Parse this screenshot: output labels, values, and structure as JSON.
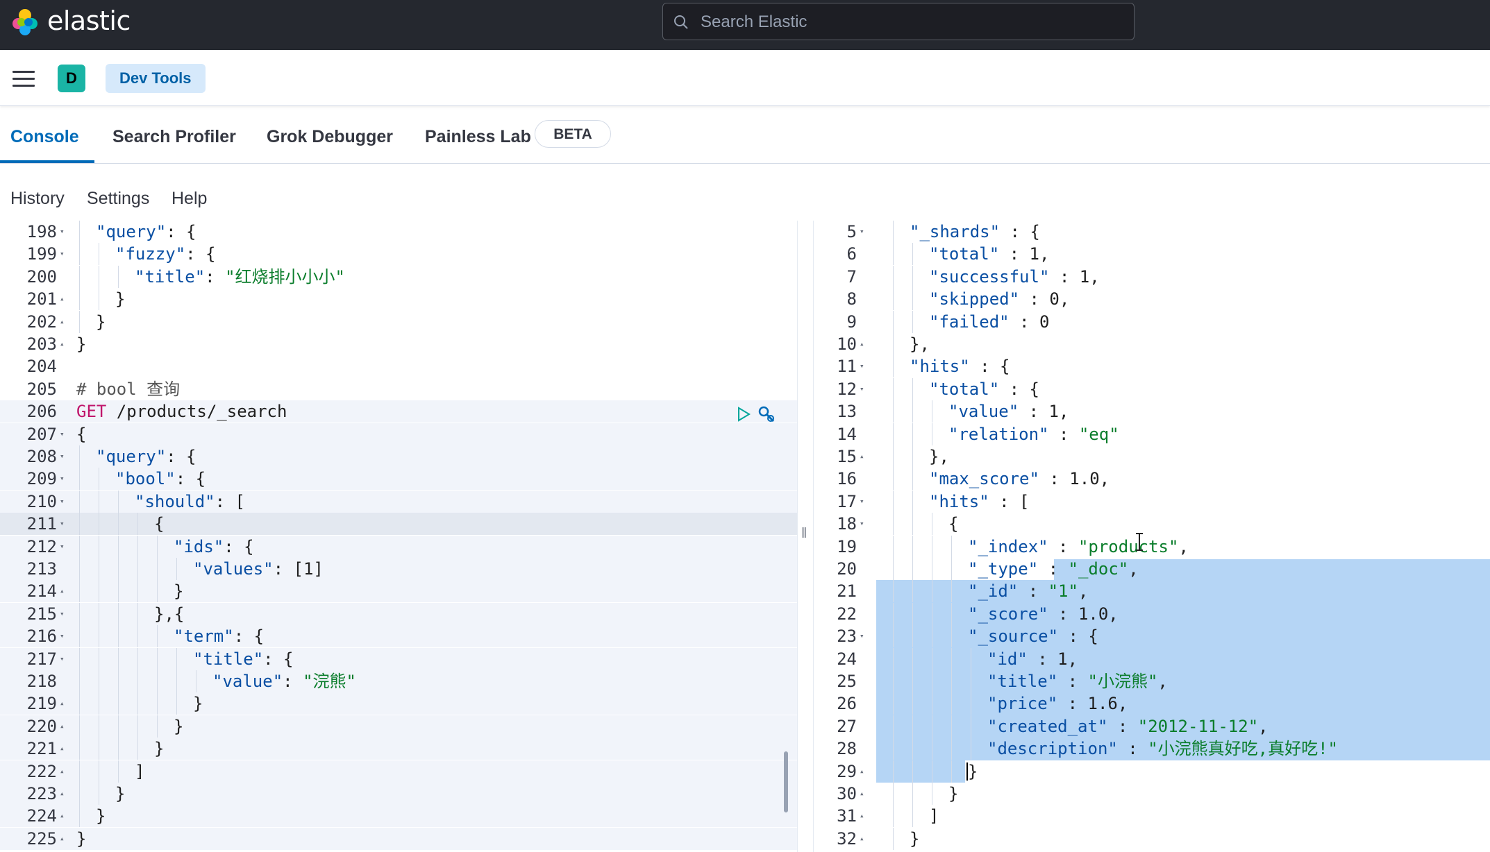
{
  "header": {
    "brand": "elastic",
    "search_placeholder": "Search Elastic"
  },
  "appbar": {
    "avatar_letter": "D",
    "breadcrumb": "Dev Tools"
  },
  "tabs": [
    {
      "label": "Console",
      "active": true
    },
    {
      "label": "Search Profiler",
      "active": false
    },
    {
      "label": "Grok Debugger",
      "active": false
    },
    {
      "label": "Painless Lab",
      "active": false
    }
  ],
  "beta_badge": "BETA",
  "subnav": [
    "History",
    "Settings",
    "Help"
  ],
  "request": {
    "lines": [
      {
        "n": "198",
        "fold": "▾",
        "indent": 1,
        "tokens": [
          [
            "k",
            "\"query\""
          ],
          [
            "p",
            ": {"
          ]
        ]
      },
      {
        "n": "199",
        "fold": "▾",
        "indent": 2,
        "tokens": [
          [
            "k",
            "\"fuzzy\""
          ],
          [
            "p",
            ": {"
          ]
        ]
      },
      {
        "n": "200",
        "fold": "",
        "indent": 3,
        "tokens": [
          [
            "k",
            "\"title\""
          ],
          [
            "p",
            ": "
          ],
          [
            "s",
            "\"红烧排小小小\""
          ]
        ]
      },
      {
        "n": "201",
        "fold": "▴",
        "indent": 2,
        "tokens": [
          [
            "p",
            "}"
          ]
        ]
      },
      {
        "n": "202",
        "fold": "▴",
        "indent": 1,
        "tokens": [
          [
            "p",
            "}"
          ]
        ]
      },
      {
        "n": "203",
        "fold": "▴",
        "indent": 0,
        "tokens": [
          [
            "p",
            "}"
          ]
        ]
      },
      {
        "n": "204",
        "fold": "",
        "indent": 0,
        "tokens": []
      },
      {
        "n": "205",
        "fold": "",
        "indent": 0,
        "tokens": [
          [
            "c",
            "# bool 查询"
          ]
        ]
      },
      {
        "n": "206",
        "fold": "",
        "indent": 0,
        "tokens": [
          [
            "m",
            "GET"
          ],
          [
            "n",
            " /products/_search"
          ]
        ]
      },
      {
        "n": "207",
        "fold": "▾",
        "indent": 0,
        "tokens": [
          [
            "p",
            "{"
          ]
        ]
      },
      {
        "n": "208",
        "fold": "▾",
        "indent": 1,
        "tokens": [
          [
            "k",
            "\"query\""
          ],
          [
            "p",
            ": {"
          ]
        ]
      },
      {
        "n": "209",
        "fold": "▾",
        "indent": 2,
        "tokens": [
          [
            "k",
            "\"bool\""
          ],
          [
            "p",
            ": {"
          ]
        ]
      },
      {
        "n": "210",
        "fold": "▾",
        "indent": 3,
        "tokens": [
          [
            "k",
            "\"should\""
          ],
          [
            "p",
            ": ["
          ]
        ]
      },
      {
        "n": "211",
        "fold": "▾",
        "indent": 4,
        "tokens": [
          [
            "p",
            "{"
          ]
        ]
      },
      {
        "n": "212",
        "fold": "▾",
        "indent": 5,
        "tokens": [
          [
            "k",
            "\"ids\""
          ],
          [
            "p",
            ": {"
          ]
        ]
      },
      {
        "n": "213",
        "fold": "",
        "indent": 6,
        "tokens": [
          [
            "k",
            "\"values\""
          ],
          [
            "p",
            ": [1]"
          ]
        ]
      },
      {
        "n": "214",
        "fold": "▴",
        "indent": 5,
        "tokens": [
          [
            "p",
            "}"
          ]
        ]
      },
      {
        "n": "215",
        "fold": "▾",
        "indent": 4,
        "tokens": [
          [
            "p",
            "},{"
          ]
        ]
      },
      {
        "n": "216",
        "fold": "▾",
        "indent": 5,
        "tokens": [
          [
            "k",
            "\"term\""
          ],
          [
            "p",
            ": {"
          ]
        ]
      },
      {
        "n": "217",
        "fold": "▾",
        "indent": 6,
        "tokens": [
          [
            "k",
            "\"title\""
          ],
          [
            "p",
            ": {"
          ]
        ]
      },
      {
        "n": "218",
        "fold": "",
        "indent": 7,
        "tokens": [
          [
            "k",
            "\"value\""
          ],
          [
            "p",
            ": "
          ],
          [
            "s",
            "\"浣熊\""
          ]
        ]
      },
      {
        "n": "219",
        "fold": "▴",
        "indent": 6,
        "tokens": [
          [
            "p",
            "}"
          ]
        ]
      },
      {
        "n": "220",
        "fold": "▴",
        "indent": 5,
        "tokens": [
          [
            "p",
            "}"
          ]
        ]
      },
      {
        "n": "221",
        "fold": "▴",
        "indent": 4,
        "tokens": [
          [
            "p",
            "}"
          ]
        ]
      },
      {
        "n": "222",
        "fold": "▴",
        "indent": 3,
        "tokens": [
          [
            "p",
            "]"
          ]
        ]
      },
      {
        "n": "223",
        "fold": "▴",
        "indent": 2,
        "tokens": [
          [
            "p",
            "}"
          ]
        ]
      },
      {
        "n": "224",
        "fold": "▴",
        "indent": 1,
        "tokens": [
          [
            "p",
            "}"
          ]
        ]
      },
      {
        "n": "225",
        "fold": "▴",
        "indent": 0,
        "tokens": [
          [
            "p",
            "}"
          ]
        ]
      }
    ]
  },
  "response": {
    "lines": [
      {
        "n": "5",
        "fold": "▾",
        "indent": 1,
        "tokens": [
          [
            "k",
            "\"_shards\""
          ],
          [
            "p",
            " : {"
          ]
        ]
      },
      {
        "n": "6",
        "fold": "",
        "indent": 2,
        "tokens": [
          [
            "k",
            "\"total\""
          ],
          [
            "p",
            " : 1,"
          ]
        ]
      },
      {
        "n": "7",
        "fold": "",
        "indent": 2,
        "tokens": [
          [
            "k",
            "\"successful\""
          ],
          [
            "p",
            " : 1,"
          ]
        ]
      },
      {
        "n": "8",
        "fold": "",
        "indent": 2,
        "tokens": [
          [
            "k",
            "\"skipped\""
          ],
          [
            "p",
            " : 0,"
          ]
        ]
      },
      {
        "n": "9",
        "fold": "",
        "indent": 2,
        "tokens": [
          [
            "k",
            "\"failed\""
          ],
          [
            "p",
            " : 0"
          ]
        ]
      },
      {
        "n": "10",
        "fold": "▴",
        "indent": 1,
        "tokens": [
          [
            "p",
            "},"
          ]
        ]
      },
      {
        "n": "11",
        "fold": "▾",
        "indent": 1,
        "tokens": [
          [
            "k",
            "\"hits\""
          ],
          [
            "p",
            " : {"
          ]
        ]
      },
      {
        "n": "12",
        "fold": "▾",
        "indent": 2,
        "tokens": [
          [
            "k",
            "\"total\""
          ],
          [
            "p",
            " : {"
          ]
        ]
      },
      {
        "n": "13",
        "fold": "",
        "indent": 3,
        "tokens": [
          [
            "k",
            "\"value\""
          ],
          [
            "p",
            " : 1,"
          ]
        ]
      },
      {
        "n": "14",
        "fold": "",
        "indent": 3,
        "tokens": [
          [
            "k",
            "\"relation\""
          ],
          [
            "p",
            " : "
          ],
          [
            "s",
            "\"eq\""
          ]
        ]
      },
      {
        "n": "15",
        "fold": "▴",
        "indent": 2,
        "tokens": [
          [
            "p",
            "},"
          ]
        ]
      },
      {
        "n": "16",
        "fold": "",
        "indent": 2,
        "tokens": [
          [
            "k",
            "\"max_score\""
          ],
          [
            "p",
            " : 1.0,"
          ]
        ]
      },
      {
        "n": "17",
        "fold": "▾",
        "indent": 2,
        "tokens": [
          [
            "k",
            "\"hits\""
          ],
          [
            "p",
            " : ["
          ]
        ]
      },
      {
        "n": "18",
        "fold": "▾",
        "indent": 3,
        "tokens": [
          [
            "p",
            "{"
          ]
        ]
      },
      {
        "n": "19",
        "fold": "",
        "indent": 4,
        "tokens": [
          [
            "k",
            "\"_index\""
          ],
          [
            "p",
            " : "
          ],
          [
            "s",
            "\"products\""
          ],
          [
            "p",
            ","
          ]
        ]
      },
      {
        "n": "20",
        "fold": "",
        "indent": 4,
        "tokens": [
          [
            "k",
            "\"_type\""
          ],
          [
            "p",
            " : "
          ],
          [
            "s",
            "\"_doc\""
          ],
          [
            "p",
            ","
          ]
        ]
      },
      {
        "n": "21",
        "fold": "",
        "indent": 4,
        "tokens": [
          [
            "k",
            "\"_id\""
          ],
          [
            "p",
            " : "
          ],
          [
            "s",
            "\"1\""
          ],
          [
            "p",
            ","
          ]
        ]
      },
      {
        "n": "22",
        "fold": "",
        "indent": 4,
        "tokens": [
          [
            "k",
            "\"_score\""
          ],
          [
            "p",
            " : 1.0,"
          ]
        ]
      },
      {
        "n": "23",
        "fold": "▾",
        "indent": 4,
        "tokens": [
          [
            "k",
            "\"_source\""
          ],
          [
            "p",
            " : {"
          ]
        ]
      },
      {
        "n": "24",
        "fold": "",
        "indent": 5,
        "tokens": [
          [
            "k",
            "\"id\""
          ],
          [
            "p",
            " : 1,"
          ]
        ]
      },
      {
        "n": "25",
        "fold": "",
        "indent": 5,
        "tokens": [
          [
            "k",
            "\"title\""
          ],
          [
            "p",
            " : "
          ],
          [
            "s",
            "\"小浣熊\""
          ],
          [
            "p",
            ","
          ]
        ]
      },
      {
        "n": "26",
        "fold": "",
        "indent": 5,
        "tokens": [
          [
            "k",
            "\"price\""
          ],
          [
            "p",
            " : 1.6,"
          ]
        ]
      },
      {
        "n": "27",
        "fold": "",
        "indent": 5,
        "tokens": [
          [
            "k",
            "\"created_at\""
          ],
          [
            "p",
            " : "
          ],
          [
            "s",
            "\"2012-11-12\""
          ],
          [
            "p",
            ","
          ]
        ]
      },
      {
        "n": "28",
        "fold": "",
        "indent": 5,
        "tokens": [
          [
            "k",
            "\"description\""
          ],
          [
            "p",
            " : "
          ],
          [
            "s",
            "\"小浣熊真好吃,真好吃!\""
          ]
        ]
      },
      {
        "n": "29",
        "fold": "▴",
        "indent": 4,
        "tokens": [
          [
            "p",
            "}"
          ]
        ]
      },
      {
        "n": "30",
        "fold": "▴",
        "indent": 3,
        "tokens": [
          [
            "p",
            "}"
          ]
        ]
      },
      {
        "n": "31",
        "fold": "▴",
        "indent": 2,
        "tokens": [
          [
            "p",
            "]"
          ]
        ]
      },
      {
        "n": "32",
        "fold": "▴",
        "indent": 1,
        "tokens": [
          [
            "p",
            "}"
          ]
        ]
      }
    ]
  },
  "colors": {
    "topbar": "#25282f",
    "accent": "#006bb8",
    "selection": "#b5d5f5",
    "request_highlight": "#f1f4fa",
    "key": "#0a4fa3",
    "string": "#0a7d2b",
    "method": "#c0156b"
  }
}
